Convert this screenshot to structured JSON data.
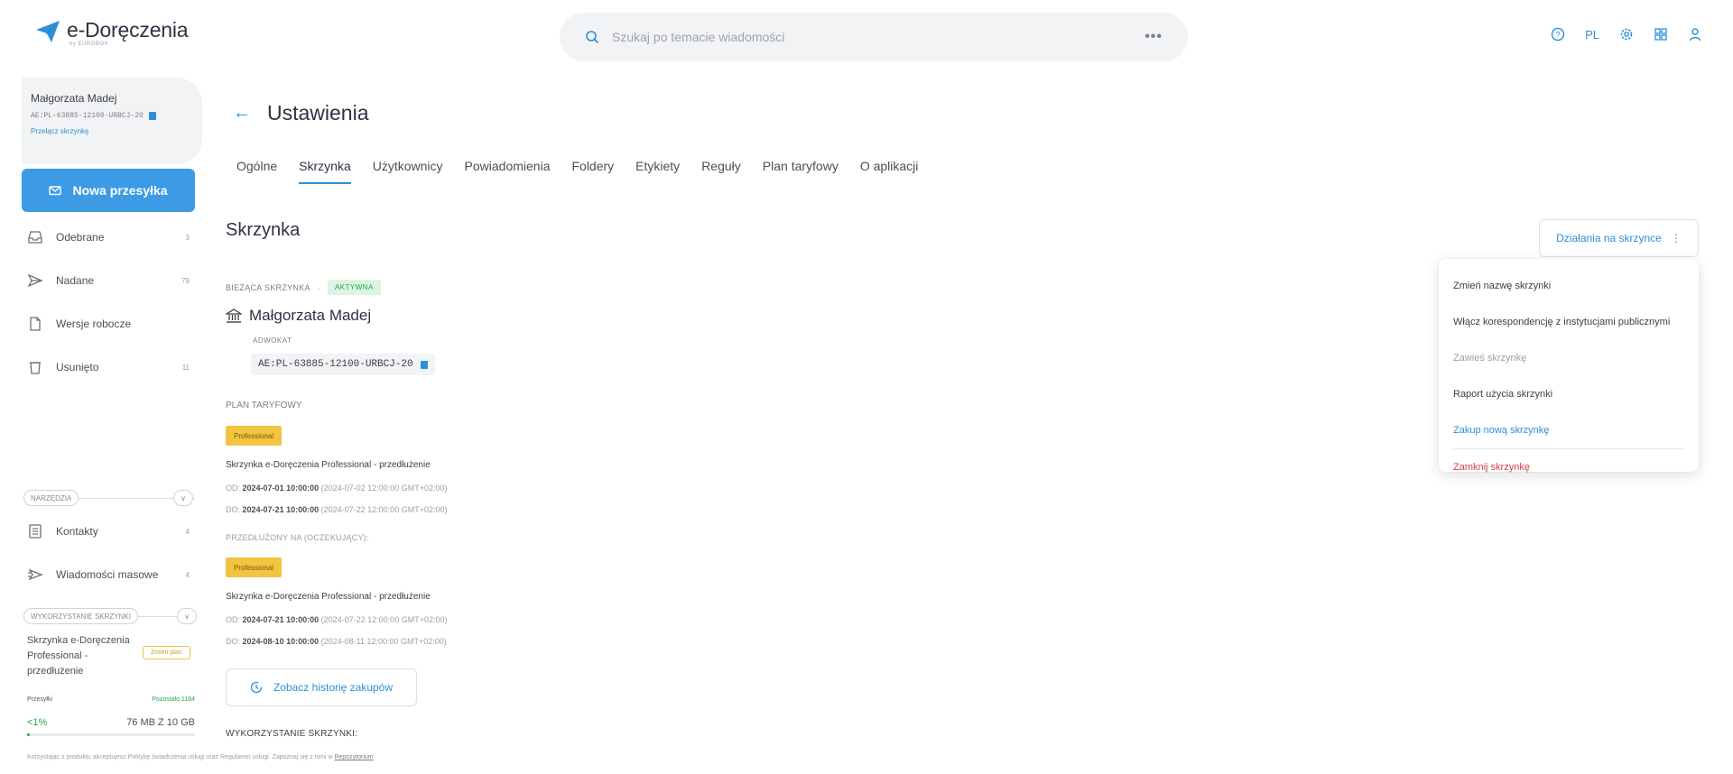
{
  "app": {
    "name": "e-Doręczenia",
    "sub": "by EUROBOX"
  },
  "search": {
    "placeholder": "Szukaj po temacie wiadomości",
    "more": "•••"
  },
  "topbar": {
    "lang": "PL"
  },
  "user": {
    "name": "Małgorzata Madej",
    "id": "AE:PL-63885-12100-URBCJ-20",
    "link": "Przełącz skrzynkę"
  },
  "sidebar": {
    "new_button": "Nowa przesyłka",
    "items": [
      {
        "label": "Odebrane",
        "count": "3"
      },
      {
        "label": "Nadane",
        "count": "79"
      },
      {
        "label": "Wersje robocze",
        "count": ""
      },
      {
        "label": "Usunięto",
        "count": "11"
      }
    ],
    "tools_label": "NARZĘDZIA",
    "tools": [
      {
        "label": "Kontakty",
        "count": "4"
      },
      {
        "label": "Wiadomości masowe",
        "count": "4"
      }
    ],
    "usage_label": "WYKORZYSTANIE SKRZYNKI",
    "plan_name": "Skrzynka e-Doręczenia Professional - przedłużenie",
    "change_plan": "Zmień plan",
    "shipments_label": "Przesyłki",
    "shipments_left": "Pozostało 1164",
    "usage_pct": "<1%",
    "usage_size": "76 MB Z 10 GB",
    "usage_fraction": 0.01
  },
  "footer": {
    "text": "Korzystając z produktu akceptujesz Politykę świadczenia usługi oraz Regulamin usługi. Zapoznaj się z nimi w ",
    "link": "Repozytorium"
  },
  "main": {
    "title": "Ustawienia",
    "tabs": [
      "Ogólne",
      "Skrzynka",
      "Użytkownicy",
      "Powiadomienia",
      "Foldery",
      "Etykiety",
      "Reguły",
      "Plan taryfowy",
      "O aplikacji"
    ],
    "active_tab": "Skrzynka",
    "section_title": "Skrzynka",
    "current_label": "BIEŻĄCA SKRZYNKA",
    "status": "AKTYWNA",
    "owner": "Małgorzata Madej",
    "role": "ADWOKAT",
    "box_id": "AE:PL-63885-12100-URBCJ-20",
    "plan_label": "PLAN TARYFOWY",
    "plan_badge": "Professional",
    "plan_name": "Skrzynka e-Doręczenia Professional - przedłużenie",
    "plan_from_prefix": "OD:",
    "plan_from": "2024-07-01 10:00:00",
    "plan_from_tz": "(2024-07-02 12:00:00 GMT+02:00)",
    "plan_to_prefix": "DO:",
    "plan_to": "2024-07-21 10:00:00",
    "plan_to_tz": "(2024-07-22 12:00:00 GMT+02:00)",
    "extended_label": "PRZEDŁUŻONY NA (OCZEKUJĄCY):",
    "ext_badge": "Professional",
    "ext_name": "Skrzynka e-Doręczenia Professional - przedłużenie",
    "ext_from": "2024-07-21 10:00:00",
    "ext_from_tz": "(2024-07-22 12:00:00 GMT+02:00)",
    "ext_to": "2024-08-10 10:00:00",
    "ext_to_tz": "(2024-08-11 12:00:00 GMT+02:00)",
    "history_button": "Zobacz historię zakupów",
    "usage_label": "WYKORZYSTANIE SKRZYNKI:"
  },
  "actions": {
    "button": "Działania na skrzynce",
    "menu": [
      "Zmień nazwę skrzynki",
      "Włącz korespondencję z instytucjami publicznymi",
      "Zawieś skrzynkę",
      "Raport użycia skrzynki",
      "Zakup nową skrzynkę",
      "Zamknij skrzynkę"
    ]
  },
  "colors": {
    "accent": "#2d8fd6",
    "primary_button": "#3c9be4",
    "success": "#2aa44a",
    "warning": "#f2c441",
    "danger": "#d93a4d"
  }
}
